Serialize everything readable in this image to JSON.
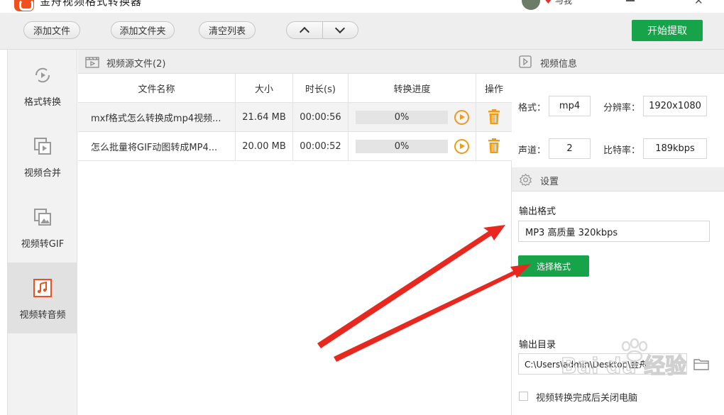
{
  "app": {
    "title": "金舟视频格式转换器",
    "user_name": "与我"
  },
  "toolbar": {
    "add_file": "添加文件",
    "add_folder": "添加文件夹",
    "clear_list": "清空列表",
    "start": "开始提取"
  },
  "sidebar": {
    "items": [
      {
        "label": "格式转换",
        "icon": "format-convert-icon"
      },
      {
        "label": "视频合并",
        "icon": "video-merge-icon"
      },
      {
        "label": "视频转GIF",
        "icon": "gif-image-icon"
      },
      {
        "label": "视频转音频",
        "icon": "music-note-icon",
        "active": true
      }
    ]
  },
  "files": {
    "section_title": "视频源文件(2)",
    "columns": {
      "name": "文件名称",
      "size": "大小",
      "duration": "时长(s)",
      "progress": "转换进度",
      "action": "操作"
    },
    "rows": [
      {
        "name": "mxf格式怎么转换成mp4视频...",
        "size": "21.64 MB",
        "duration": "00:00:56",
        "progress": "0%"
      },
      {
        "name": "怎么批量将GIF动图转成MP4...",
        "size": "20.00 MB",
        "duration": "00:00:52",
        "progress": "0%"
      }
    ]
  },
  "video_info": {
    "title": "视频信息",
    "format_label": "格式：",
    "format": "mp4",
    "resolution_label": "分辨率：",
    "resolution": "1920x1080",
    "channel_label": "声道：",
    "channel": "2",
    "bitrate_label": "比特率：",
    "bitrate": "189kbps"
  },
  "settings": {
    "title": "设置",
    "output_format_label": "输出格式",
    "output_format": "MP3 高质量 320kbps",
    "choose_format": "选择格式",
    "output_dir_label": "输出目录",
    "output_dir": "C:\\Users\\admin\\Desktop\\金舟",
    "shutdown_label": "视频转换完成后关闭电脑"
  },
  "watermark": {
    "text": "Bai du 经验"
  },
  "colors": {
    "accent_green": "#17a34a",
    "arrow_red": "#e8281e",
    "icon_orange": "#f09a1a",
    "active_icon": "#f0501e"
  }
}
